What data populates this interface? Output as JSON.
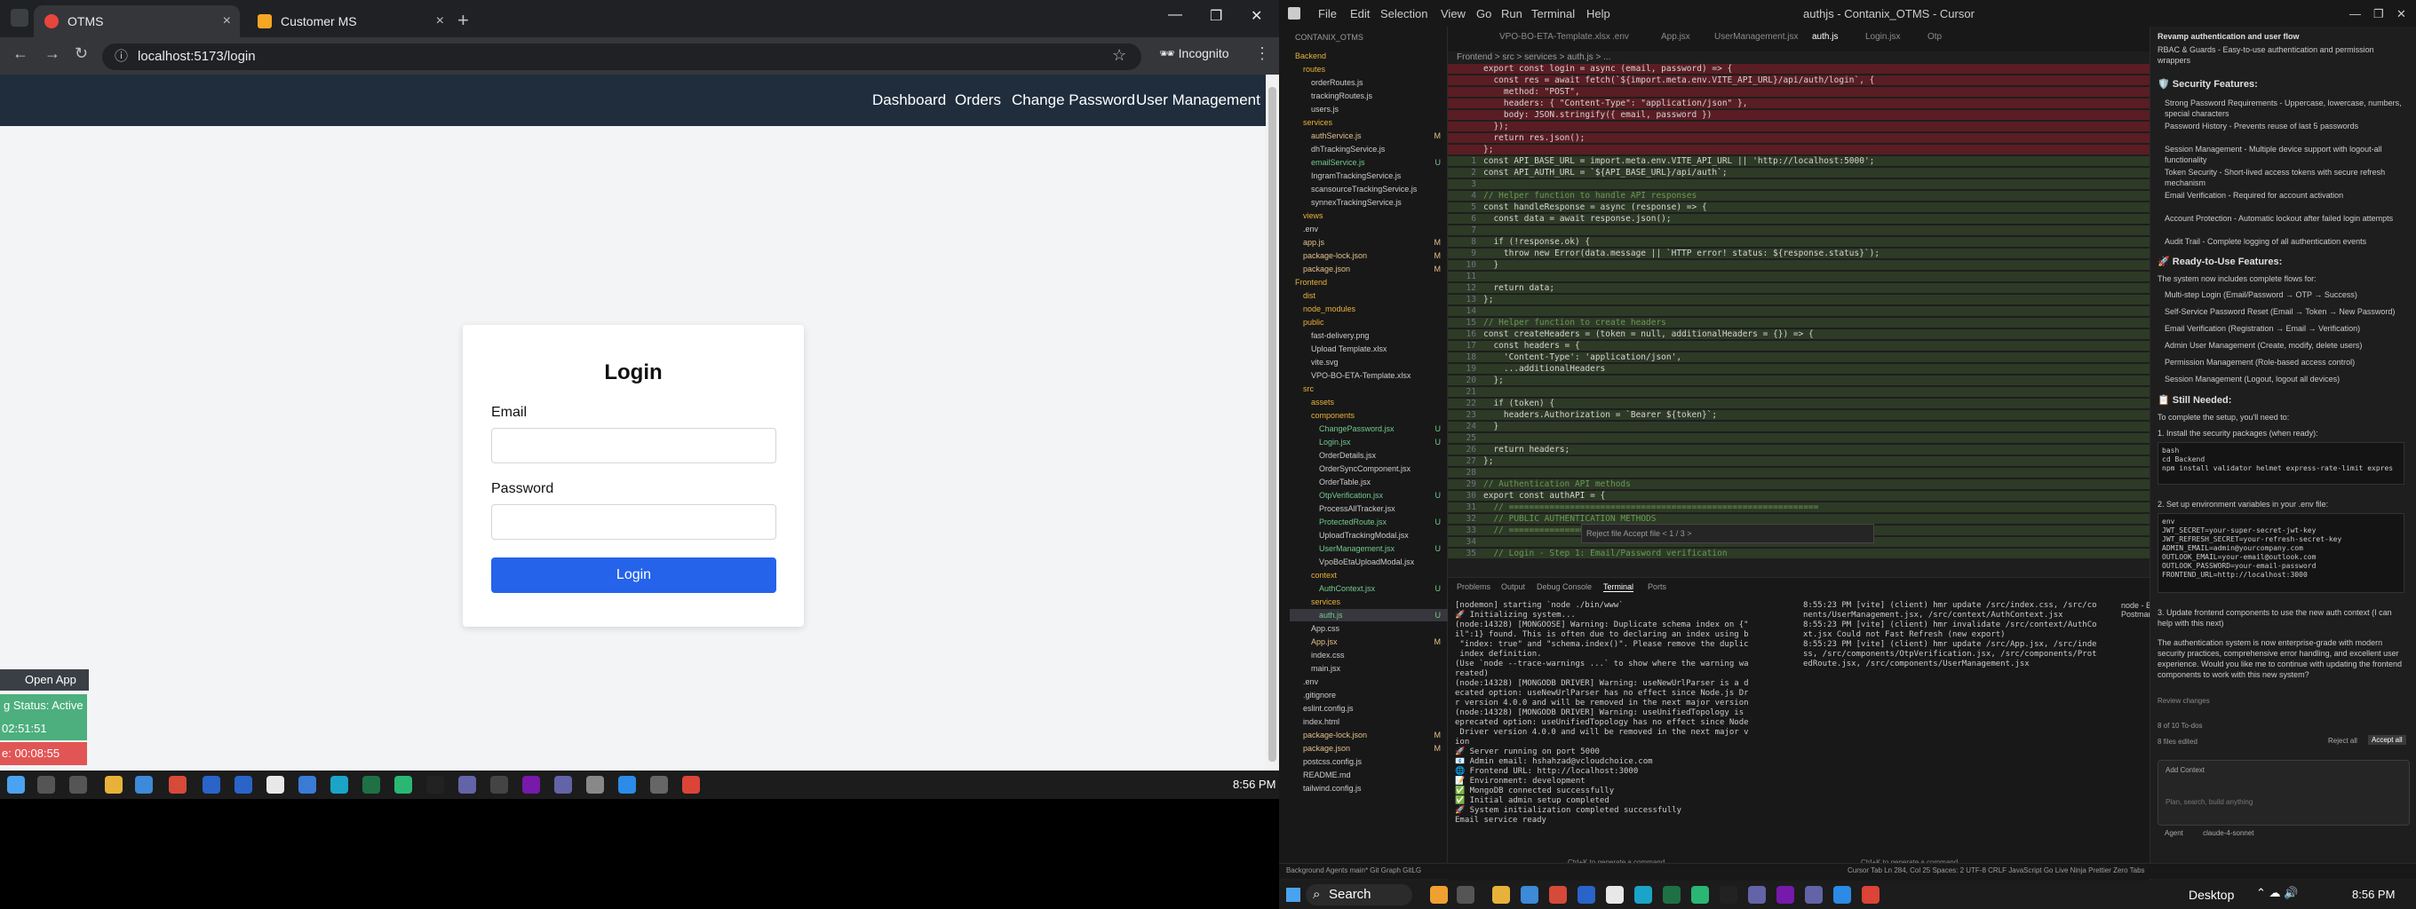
{
  "browser": {
    "tabs": [
      {
        "title": "OTMS"
      },
      {
        "title": "Customer MS"
      }
    ],
    "url": "localhost:5173/login",
    "incognito_label": "Incognito"
  },
  "app": {
    "nav": [
      "Dashboard",
      "Orders",
      "Change Password",
      "User Management"
    ],
    "login": {
      "title": "Login",
      "email_label": "Email",
      "password_label": "Password",
      "button": "Login"
    },
    "widget": {
      "open_app": "Open App",
      "status": "g Status: Active",
      "time1": "02:51:51",
      "time2": "e: 00:08:55"
    }
  },
  "left_taskbar": {
    "time": "8:56 PM"
  },
  "ide": {
    "menus": [
      "File",
      "Edit",
      "Selection",
      "View",
      "Go",
      "Run",
      "Terminal",
      "Help"
    ],
    "title": "authjs - Contanix_OTMS - Cursor",
    "explorer_header": "CONTANIX_OTMS",
    "tree": [
      {
        "label": "Backend",
        "depth": 0,
        "badge": ""
      },
      {
        "label": "routes",
        "depth": 1,
        "badge": ""
      },
      {
        "label": "orderRoutes.js",
        "depth": 2,
        "badge": ""
      },
      {
        "label": "trackingRoutes.js",
        "depth": 2,
        "badge": ""
      },
      {
        "label": "users.js",
        "depth": 2,
        "badge": ""
      },
      {
        "label": "services",
        "depth": 1,
        "badge": ""
      },
      {
        "label": "authService.js",
        "depth": 2,
        "badge": "M"
      },
      {
        "label": "dhTrackingService.js",
        "depth": 2,
        "badge": ""
      },
      {
        "label": "emailService.js",
        "depth": 2,
        "badge": "U"
      },
      {
        "label": "IngramTrackingService.js",
        "depth": 2,
        "badge": ""
      },
      {
        "label": "scansourceTrackingService.js",
        "depth": 2,
        "badge": ""
      },
      {
        "label": "synnexTrackingService.js",
        "depth": 2,
        "badge": ""
      },
      {
        "label": "views",
        "depth": 1,
        "badge": ""
      },
      {
        "label": ".env",
        "depth": 1,
        "badge": ""
      },
      {
        "label": "app.js",
        "depth": 1,
        "badge": "M"
      },
      {
        "label": "package-lock.json",
        "depth": 1,
        "badge": "M"
      },
      {
        "label": "package.json",
        "depth": 1,
        "badge": "M"
      },
      {
        "label": "Frontend",
        "depth": 0,
        "badge": ""
      },
      {
        "label": "dist",
        "depth": 1,
        "badge": ""
      },
      {
        "label": "node_modules",
        "depth": 1,
        "badge": ""
      },
      {
        "label": "public",
        "depth": 1,
        "badge": ""
      },
      {
        "label": "fast-delivery.png",
        "depth": 2,
        "badge": ""
      },
      {
        "label": "Upload Template.xlsx",
        "depth": 2,
        "badge": ""
      },
      {
        "label": "vite.svg",
        "depth": 2,
        "badge": ""
      },
      {
        "label": "VPO-BO-ETA-Template.xlsx",
        "depth": 2,
        "badge": ""
      },
      {
        "label": "src",
        "depth": 1,
        "badge": ""
      },
      {
        "label": "assets",
        "depth": 2,
        "badge": ""
      },
      {
        "label": "components",
        "depth": 2,
        "badge": ""
      },
      {
        "label": "ChangePassword.jsx",
        "depth": 3,
        "badge": "U"
      },
      {
        "label": "Login.jsx",
        "depth": 3,
        "badge": "U"
      },
      {
        "label": "OrderDetails.jsx",
        "depth": 3,
        "badge": ""
      },
      {
        "label": "OrderSyncComponent.jsx",
        "depth": 3,
        "badge": ""
      },
      {
        "label": "OrderTable.jsx",
        "depth": 3,
        "badge": ""
      },
      {
        "label": "OtpVerification.jsx",
        "depth": 3,
        "badge": "U"
      },
      {
        "label": "ProcessAllTracker.jsx",
        "depth": 3,
        "badge": ""
      },
      {
        "label": "ProtectedRoute.jsx",
        "depth": 3,
        "badge": "U"
      },
      {
        "label": "UploadTrackingModal.jsx",
        "depth": 3,
        "badge": ""
      },
      {
        "label": "UserManagement.jsx",
        "depth": 3,
        "badge": "U"
      },
      {
        "label": "VpoBoEtaUploadModal.jsx",
        "depth": 3,
        "badge": ""
      },
      {
        "label": "context",
        "depth": 2,
        "badge": ""
      },
      {
        "label": "AuthContext.jsx",
        "depth": 3,
        "badge": "U"
      },
      {
        "label": "services",
        "depth": 2,
        "badge": ""
      },
      {
        "label": "auth.js",
        "depth": 3,
        "badge": "U"
      },
      {
        "label": "App.css",
        "depth": 2,
        "badge": ""
      },
      {
        "label": "App.jsx",
        "depth": 2,
        "badge": "M"
      },
      {
        "label": "index.css",
        "depth": 2,
        "badge": ""
      },
      {
        "label": "main.jsx",
        "depth": 2,
        "badge": ""
      },
      {
        "label": ".env",
        "depth": 1,
        "badge": ""
      },
      {
        "label": ".gitignore",
        "depth": 1,
        "badge": ""
      },
      {
        "label": "eslint.config.js",
        "depth": 1,
        "badge": ""
      },
      {
        "label": "index.html",
        "depth": 1,
        "badge": ""
      },
      {
        "label": "package-lock.json",
        "depth": 1,
        "badge": "M"
      },
      {
        "label": "package.json",
        "depth": 1,
        "badge": "M"
      },
      {
        "label": "postcss.config.js",
        "depth": 1,
        "badge": ""
      },
      {
        "label": "README.md",
        "depth": 1,
        "badge": ""
      },
      {
        "label": "tailwind.config.js",
        "depth": 1,
        "badge": ""
      }
    ],
    "editor_tabs": [
      "VPO-BO-ETA-Template.xlsx",
      ".env",
      "App.jsx",
      "UserManagement.jsx",
      "auth.js",
      "Login.jsx",
      "Otp"
    ],
    "breadcrumb": "Frontend > src > services > auth.js > ...",
    "code_lines": [
      {
        "n": "",
        "t": "export const login = async (email, password) => {",
        "k": "del"
      },
      {
        "n": "",
        "t": "  const res = await fetch(`${import.meta.env.VITE_API_URL}/api/auth/login`, {",
        "k": "del"
      },
      {
        "n": "",
        "t": "    method: \"POST\",",
        "k": "del"
      },
      {
        "n": "",
        "t": "    headers: { \"Content-Type\": \"application/json\" },",
        "k": "del"
      },
      {
        "n": "",
        "t": "    body: JSON.stringify({ email, password })",
        "k": "del"
      },
      {
        "n": "",
        "t": "  });",
        "k": "del"
      },
      {
        "n": "",
        "t": "  return res.json();",
        "k": "del"
      },
      {
        "n": "",
        "t": "};",
        "k": "del"
      },
      {
        "n": "1",
        "t": "const API_BASE_URL = import.meta.env.VITE_API_URL || 'http://localhost:5000';",
        "k": "add"
      },
      {
        "n": "2",
        "t": "const API_AUTH_URL = `${API_BASE_URL}/api/auth`;",
        "k": "add"
      },
      {
        "n": "3",
        "t": "",
        "k": "add"
      },
      {
        "n": "4",
        "t": "// Helper function to handle API responses",
        "k": "add cm"
      },
      {
        "n": "5",
        "t": "const handleResponse = async (response) => {",
        "k": "add"
      },
      {
        "n": "6",
        "t": "  const data = await response.json();",
        "k": "add"
      },
      {
        "n": "7",
        "t": "",
        "k": "add"
      },
      {
        "n": "8",
        "t": "  if (!response.ok) {",
        "k": "add"
      },
      {
        "n": "9",
        "t": "    throw new Error(data.message || `HTTP error! status: ${response.status}`);",
        "k": "add"
      },
      {
        "n": "10",
        "t": "  }",
        "k": "add"
      },
      {
        "n": "11",
        "t": "",
        "k": "add"
      },
      {
        "n": "12",
        "t": "  return data;",
        "k": "add"
      },
      {
        "n": "13",
        "t": "};",
        "k": "add"
      },
      {
        "n": "14",
        "t": "",
        "k": "add"
      },
      {
        "n": "15",
        "t": "// Helper function to create headers",
        "k": "add cm"
      },
      {
        "n": "16",
        "t": "const createHeaders = (token = null, additionalHeaders = {}) => {",
        "k": "add"
      },
      {
        "n": "17",
        "t": "  const headers = {",
        "k": "add"
      },
      {
        "n": "18",
        "t": "    'Content-Type': 'application/json',",
        "k": "add"
      },
      {
        "n": "19",
        "t": "    ...additionalHeaders",
        "k": "add"
      },
      {
        "n": "20",
        "t": "  };",
        "k": "add"
      },
      {
        "n": "21",
        "t": "",
        "k": "add"
      },
      {
        "n": "22",
        "t": "  if (token) {",
        "k": "add"
      },
      {
        "n": "23",
        "t": "    headers.Authorization = `Bearer ${token}`;",
        "k": "add"
      },
      {
        "n": "24",
        "t": "  }",
        "k": "add"
      },
      {
        "n": "25",
        "t": "",
        "k": "add"
      },
      {
        "n": "26",
        "t": "  return headers;",
        "k": "add"
      },
      {
        "n": "27",
        "t": "};",
        "k": "add"
      },
      {
        "n": "28",
        "t": "",
        "k": "add"
      },
      {
        "n": "29",
        "t": "// Authentication API methods",
        "k": "add cm"
      },
      {
        "n": "30",
        "t": "export const authAPI = {",
        "k": "add"
      },
      {
        "n": "31",
        "t": "  // =============================================================",
        "k": "add cm"
      },
      {
        "n": "32",
        "t": "  // PUBLIC AUTHENTICATION METHODS",
        "k": "add cm"
      },
      {
        "n": "33",
        "t": "  // =============================================================",
        "k": "add cm"
      },
      {
        "n": "34",
        "t": "",
        "k": "add"
      },
      {
        "n": "35",
        "t": "  // Login - Step 1: Email/Password verification",
        "k": "add cm"
      }
    ],
    "find_widget": "Reject file  Accept file  < 1 / 3 >",
    "panel_tabs": [
      "Problems",
      "Output",
      "Debug Console",
      "Terminal",
      "Ports"
    ],
    "terminal_left": [
      "[nodemon] starting `node ./bin/www`",
      "🚀 Initializing system...",
      "(node:14328) [MONGOOSE] Warning: Duplicate schema index on {\"ema",
      "il\":1} found. This is often due to declaring an index using both",
      " \"index: true\" and \"schema.index()\". Please remove the duplicate",
      " index definition.",
      "(Use `node --trace-warnings ...` to show where the warning was c",
      "reated)",
      "(node:14328) [MONGODB DRIVER] Warning: useNewUrlParser is a depr",
      "ecated option: useNewUrlParser has no effect since Node.js Drive",
      "r version 4.0.0 and will be removed in the next major version",
      "(node:14328) [MONGODB DRIVER] Warning: useUnifiedTopology is a d",
      "eprecated option: useUnifiedTopology has no effect since Node.js",
      " Driver version 4.0.0 and will be removed in the next major vers",
      "ion",
      "🚀 Server running on port 5000",
      "📧 Admin email: hshahzad@vcloudchoice.com",
      "🌐 Frontend URL: http://localhost:3000",
      "📝 Environment: development",
      "✅ MongoDB connected successfully",
      "✅ Initial admin setup completed",
      "🚀 System initialization completed successfully",
      "Email service ready"
    ],
    "terminal_right": [
      "8:55:23 PM [vite] (client) hmr update /src/index.css, /src/compo",
      "nents/UserManagement.jsx, /src/context/AuthContext.jsx",
      "8:55:23 PM [vite] (client) hmr invalidate /src/context/AuthConte",
      "xt.jsx Could not Fast Refresh (new export)",
      "8:55:23 PM [vite] (client) hmr update /src/App.jsx, /src/index.c",
      "ss, /src/components/OtpVerification.jsx, /src/components/Protect",
      "edRoute.jsx, /src/components/UserManagement.jsx"
    ],
    "terminal_side": [
      "node - Backend",
      "Postman"
    ],
    "terminal_hint": "Ctrl+K to generate a command",
    "chat": {
      "header": "Revamp authentication and user flow",
      "top_line": "RBAC & Guards - Easy-to-use authentication and permission wrappers",
      "security_title": "🛡️ Security Features:",
      "security_items": [
        "Strong Password Requirements - Uppercase, lowercase, numbers, special characters",
        "Password History - Prevents reuse of last 5 passwords",
        "Session Management - Multiple device support with logout-all functionality",
        "Token Security - Short-lived access tokens with secure refresh mechanism",
        "Email Verification - Required for account activation",
        "Account Protection - Automatic lockout after failed login attempts",
        "Audit Trail - Complete logging of all authentication events"
      ],
      "ready_title": "🚀 Ready-to-Use Features:",
      "ready_intro": "The system now includes complete flows for:",
      "ready_items": [
        "Multi-step Login (Email/Password → OTP → Success)",
        "Self-Service Password Reset (Email → Token → New Password)",
        "Email Verification (Registration → Email → Verification)",
        "Admin User Management (Create, modify, delete users)",
        "Permission Management (Role-based access control)",
        "Session Management (Logout, logout all devices)"
      ],
      "still_title": "📋 Still Needed:",
      "still_intro": "To complete the setup, you'll need to:",
      "step1": "1. Install the security packages (when ready):",
      "code1": "bash\ncd Backend\nnpm install validator helmet express-rate-limit expres",
      "step2": "2. Set up environment variables in your .env file:",
      "code2": "env\nJWT_SECRET=your-super-secret-jwt-key\nJWT_REFRESH_SECRET=your-refresh-secret-key\nADMIN_EMAIL=admin@yourcompany.com\nOUTLOOK_EMAIL=your-email@outlook.com\nOUTLOOK_PASSWORD=your-email-password\nFRONTEND_URL=http://localhost:3000",
      "step3": "3. Update frontend components to use the new auth context (I can help with this next)",
      "outro": "The authentication system is now enterprise-grade with modern security practices, comprehensive error handling, and excellent user experience. Would you like me to continue with updating the frontend components to work with this new system?",
      "review": "Review changes",
      "files_label": "8 of 10 To-dos",
      "files_edited": "8 files edited",
      "reject_all": "Reject all",
      "accept_all": "Accept all",
      "add_context": "Add Context",
      "placeholder": "Plan, search, build anything",
      "agent": "Agent",
      "model": "claude-4-sonnet"
    },
    "status": {
      "left": "Background Agents   main*   Git Graph   GitLG",
      "right": "Cursor Tab   Ln 284, Col 25   Spaces: 2   UTF-8   CRLF   JavaScript   Go Live   Ninja   Prettier   Zero Tabs"
    }
  },
  "right_taskbar": {
    "search": "Search",
    "desktop": "Desktop",
    "time": "8:56 PM"
  }
}
